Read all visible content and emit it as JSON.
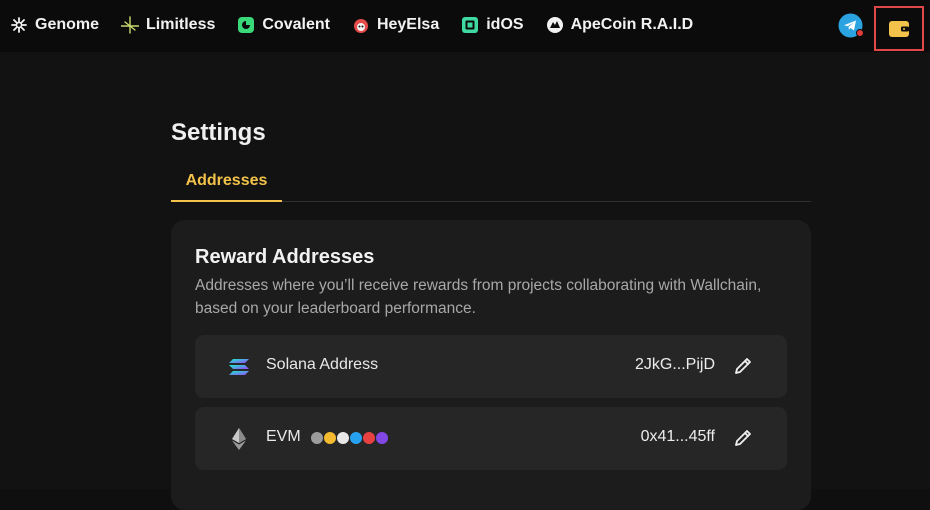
{
  "nav": {
    "items": [
      {
        "label": "Genome",
        "icon": "asterisk-icon"
      },
      {
        "label": "Limitless",
        "icon": "limitless-icon"
      },
      {
        "label": "Covalent",
        "icon": "covalent-icon"
      },
      {
        "label": "HeyElsa",
        "icon": "heyelsa-icon"
      },
      {
        "label": "idOS",
        "icon": "idos-icon"
      },
      {
        "label": "ApeCoin R.A.I.D",
        "icon": "apecoin-icon"
      }
    ],
    "telegram_icon": "telegram-icon",
    "wallet_icon": "wallet-icon",
    "accent": "#f2c24a",
    "highlight_border": "#e04848"
  },
  "settings": {
    "title": "Settings",
    "tabs": [
      {
        "label": "Addresses",
        "active": true
      }
    ]
  },
  "rewards": {
    "title": "Reward Addresses",
    "description": "Addresses where you’ll receive rewards from projects collaborating with Wallchain, based on your leaderboard performance.",
    "rows": [
      {
        "label": "Solana Address",
        "address": "2JkG...PijD",
        "icon": "solana-icon"
      },
      {
        "label": "EVM",
        "address": "0x41...45ff",
        "icon": "ethereum-icon",
        "chain_badges": [
          "#9c9c9c",
          "#f3ba2f",
          "#e8e8e8",
          "#28a0f0",
          "#e84142",
          "#8247e5"
        ]
      }
    ]
  }
}
